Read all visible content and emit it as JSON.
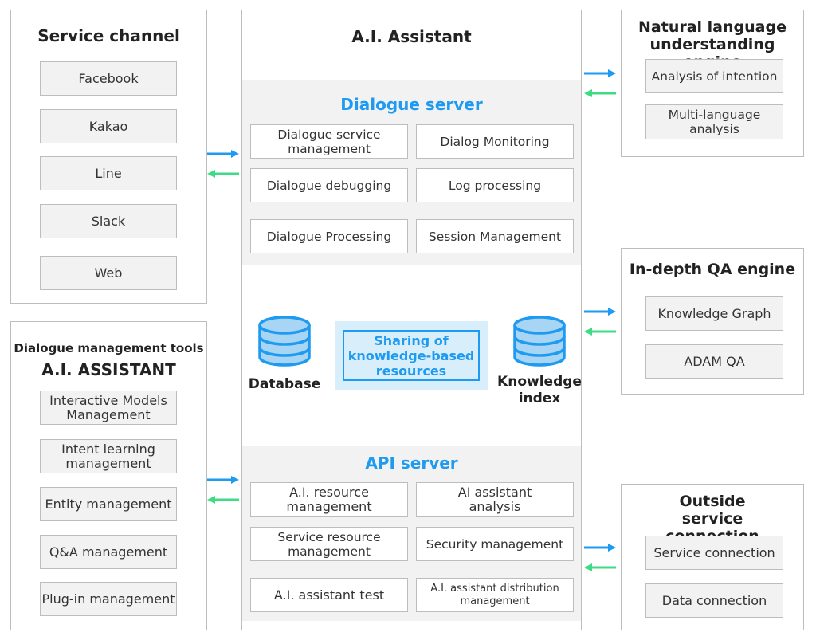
{
  "service_channel": {
    "title": "Service channel",
    "items": [
      "Facebook",
      "Kakao",
      "Line",
      "Slack",
      "Web"
    ]
  },
  "dialogue_tools": {
    "subtitle": "Dialogue management tools",
    "title": "A.I. ASSISTANT",
    "items": [
      "Interactive Models Management",
      "Intent learning management",
      "Entity management",
      "Q&A management",
      "Plug-in management"
    ]
  },
  "assistant": {
    "title": "A.I. Assistant",
    "dialogue_server": {
      "title": "Dialogue server",
      "items": [
        "Dialogue service management",
        "Dialog Monitoring",
        "Dialogue debugging",
        "Log processing",
        "Dialogue Processing",
        "Session Management"
      ]
    },
    "database_label": "Database",
    "sharing_label": "Sharing of knowledge-based resources",
    "knowledge_index_label": "Knowledge index",
    "api_server": {
      "title": "API server",
      "items": [
        "A.I. resource management",
        "AI assistant analysis",
        "Service resource management",
        "Security management",
        "A.I. assistant test",
        "A.I. assistant distribution management"
      ]
    }
  },
  "nlu_engine": {
    "title": "Natural language understanding engine",
    "items": [
      "Analysis of intention",
      "Multi-language analysis"
    ]
  },
  "qa_engine": {
    "title": "In-depth QA engine",
    "items": [
      "Knowledge Graph",
      "ADAM QA"
    ]
  },
  "outside_service": {
    "title": "Outside service connection",
    "items": [
      "Service connection",
      "Data connection"
    ]
  },
  "colors": {
    "accent_blue": "#1e9bf0",
    "arrow_green": "#3ddc84",
    "box_fill": "#f2f2f2",
    "sharing_fill": "#d9eefb"
  }
}
